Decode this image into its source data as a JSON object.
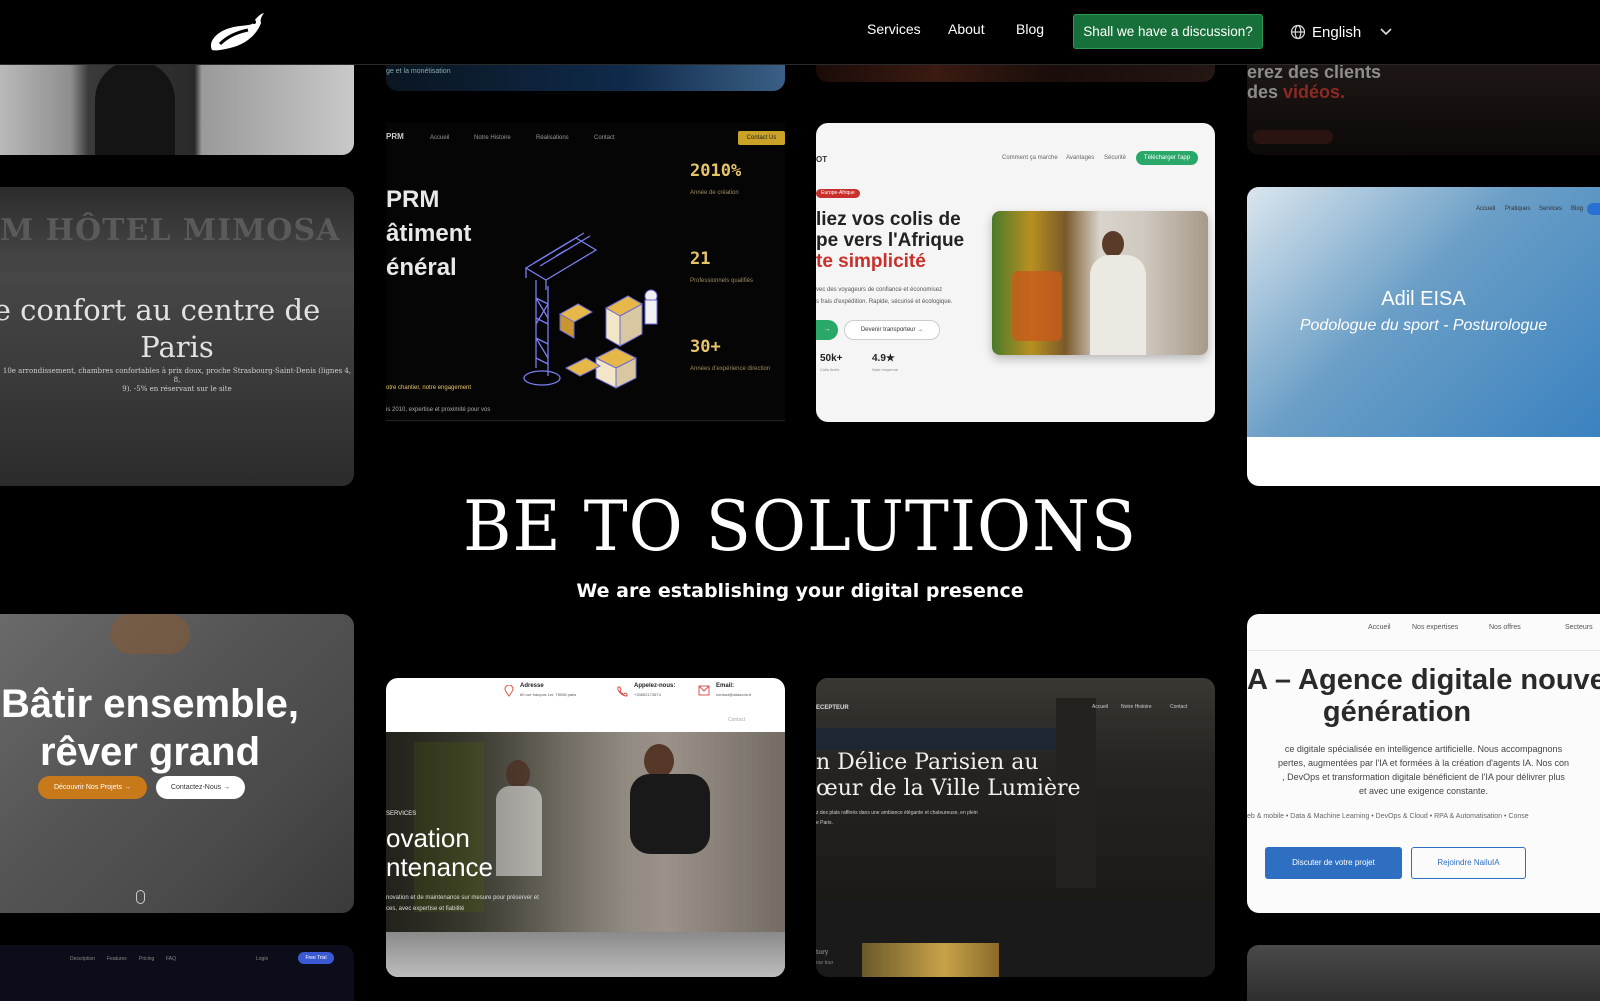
{
  "header": {
    "nav": [
      "Services",
      "About",
      "Blog"
    ],
    "cta_label": "Shall we have a discussion?",
    "language": "English"
  },
  "hero": {
    "title": "BE TO SOLUTIONS",
    "subtitle": "We are establishing your digital presence"
  },
  "cards": {
    "top_mid_tagline": "ge et la monétisation",
    "top_right_line1": "erez des clients",
    "top_right_line2a": "des ",
    "top_right_line2b": "vidéos.",
    "hotel": {
      "title_line1": "e confort au centre de",
      "title_line2": "Paris",
      "desc_line1": "10e arrondissement, chambres confortables à prix doux, proche Strasbourg-Saint-Denis (lignes 4, 8,",
      "desc_line2": "9). -5% en réservant sur le site"
    },
    "prm": {
      "nav": [
        "Accueil",
        "Notre Histoire",
        "Réalisations",
        "Contact"
      ],
      "cta": "Contact Us",
      "logo": "PRM",
      "title": [
        "PRM",
        "âtiment",
        "énéral"
      ],
      "stats": [
        {
          "value": "2010%",
          "label": "Année de création"
        },
        {
          "value": "21",
          "label": "Professionnels qualifiés"
        },
        {
          "value": "30+",
          "label": "Années d'expérience direction"
        }
      ],
      "footer1": "otre chantier, notre engagement",
      "footer2": "is 2010, expertise et proximité pour vos"
    },
    "parcel": {
      "brand": "OT",
      "nav": [
        "Comment ça marche",
        "Avantages",
        "Sécurité"
      ],
      "cta": "Télécharger l'app",
      "badge": "Europe-Afrique",
      "title": [
        "liez vos colis de",
        "pe vers l'Afrique",
        "te simplicité"
      ],
      "desc": "vec des voyageurs de confiance et économisez",
      "desc2": "s frais d'expédition. Rapide, sécurisé et écologique.",
      "button": "Devenir transporteur →",
      "stats": [
        {
          "value": "50k+",
          "label": "Colis livrés"
        },
        {
          "value": "4.9★",
          "label": "Note moyenne"
        }
      ]
    },
    "adil": {
      "nav": [
        "Accueil",
        "Pratiques",
        "Services",
        "Blog"
      ],
      "name": "Adil EISA",
      "role": "Podologue du sport - Posturologue"
    },
    "batir": {
      "title_line1": "Bâtir ensemble,",
      "title_line2": "rêver grand",
      "button1": "Découvrir Nos Projets →",
      "button2": "Contactez-Nous →"
    },
    "renov": {
      "contacts": [
        {
          "label": "Adresse",
          "value": "60 rue françois 1er, 75008 paris"
        },
        {
          "label": "Appelez-nous:",
          "value": "+33652173674"
        },
        {
          "label": "Email:",
          "value": "contact@oitasons.fr"
        }
      ],
      "nav_contact": "Contact",
      "kicker": "SERVICES",
      "title_line1": "ovation",
      "title_line2": "ntenance",
      "desc_line1": "novation et de maintenance sur mesure pour préserver et",
      "desc_line2": "ces, avec expertise et fiabilité"
    },
    "delice": {
      "brand": "ECEPTEUR",
      "nav": [
        "Accueil",
        "Notre Histoire",
        "Contact"
      ],
      "title_line1": "n Délice Parisien au",
      "title_line2": "œur de la Ville Lumière",
      "desc": "z des plats raffinés dans une ambiance élégante et chaleureuse, en plein",
      "desc2": "e Paris.",
      "footer1": "tory",
      "footer2": "our tour"
    },
    "agence": {
      "nav": [
        "Accueil",
        "Nos expertises",
        "Nos offres",
        "Secteurs"
      ],
      "title_line1": "A – Agence digitale nouve",
      "title_line2": "génération",
      "desc_line1": "ce digitale spécialisée en intelligence artificielle. Nous accompagnons",
      "desc_line2": "pertes, augmentées par l'IA et formées à la création d'agents IA. Nos con",
      "desc_line3": ", DevOps et transformation digitale bénéficient de l'IA pour délivrer plus",
      "desc_line4": "et avec une exigence constante.",
      "tags": "eb & mobile • Data & Machine Learning • DevOps & Cloud • RPA & Automatisation • Conse",
      "button1": "Discuter de votre projet",
      "button2": "Rejoindre NailuIA"
    },
    "bottom_left_nav": [
      "Description",
      "Features",
      "Pricing",
      "FAQ"
    ],
    "bottom_left_login": "Login",
    "bottom_left_cta": "Free Trial"
  }
}
